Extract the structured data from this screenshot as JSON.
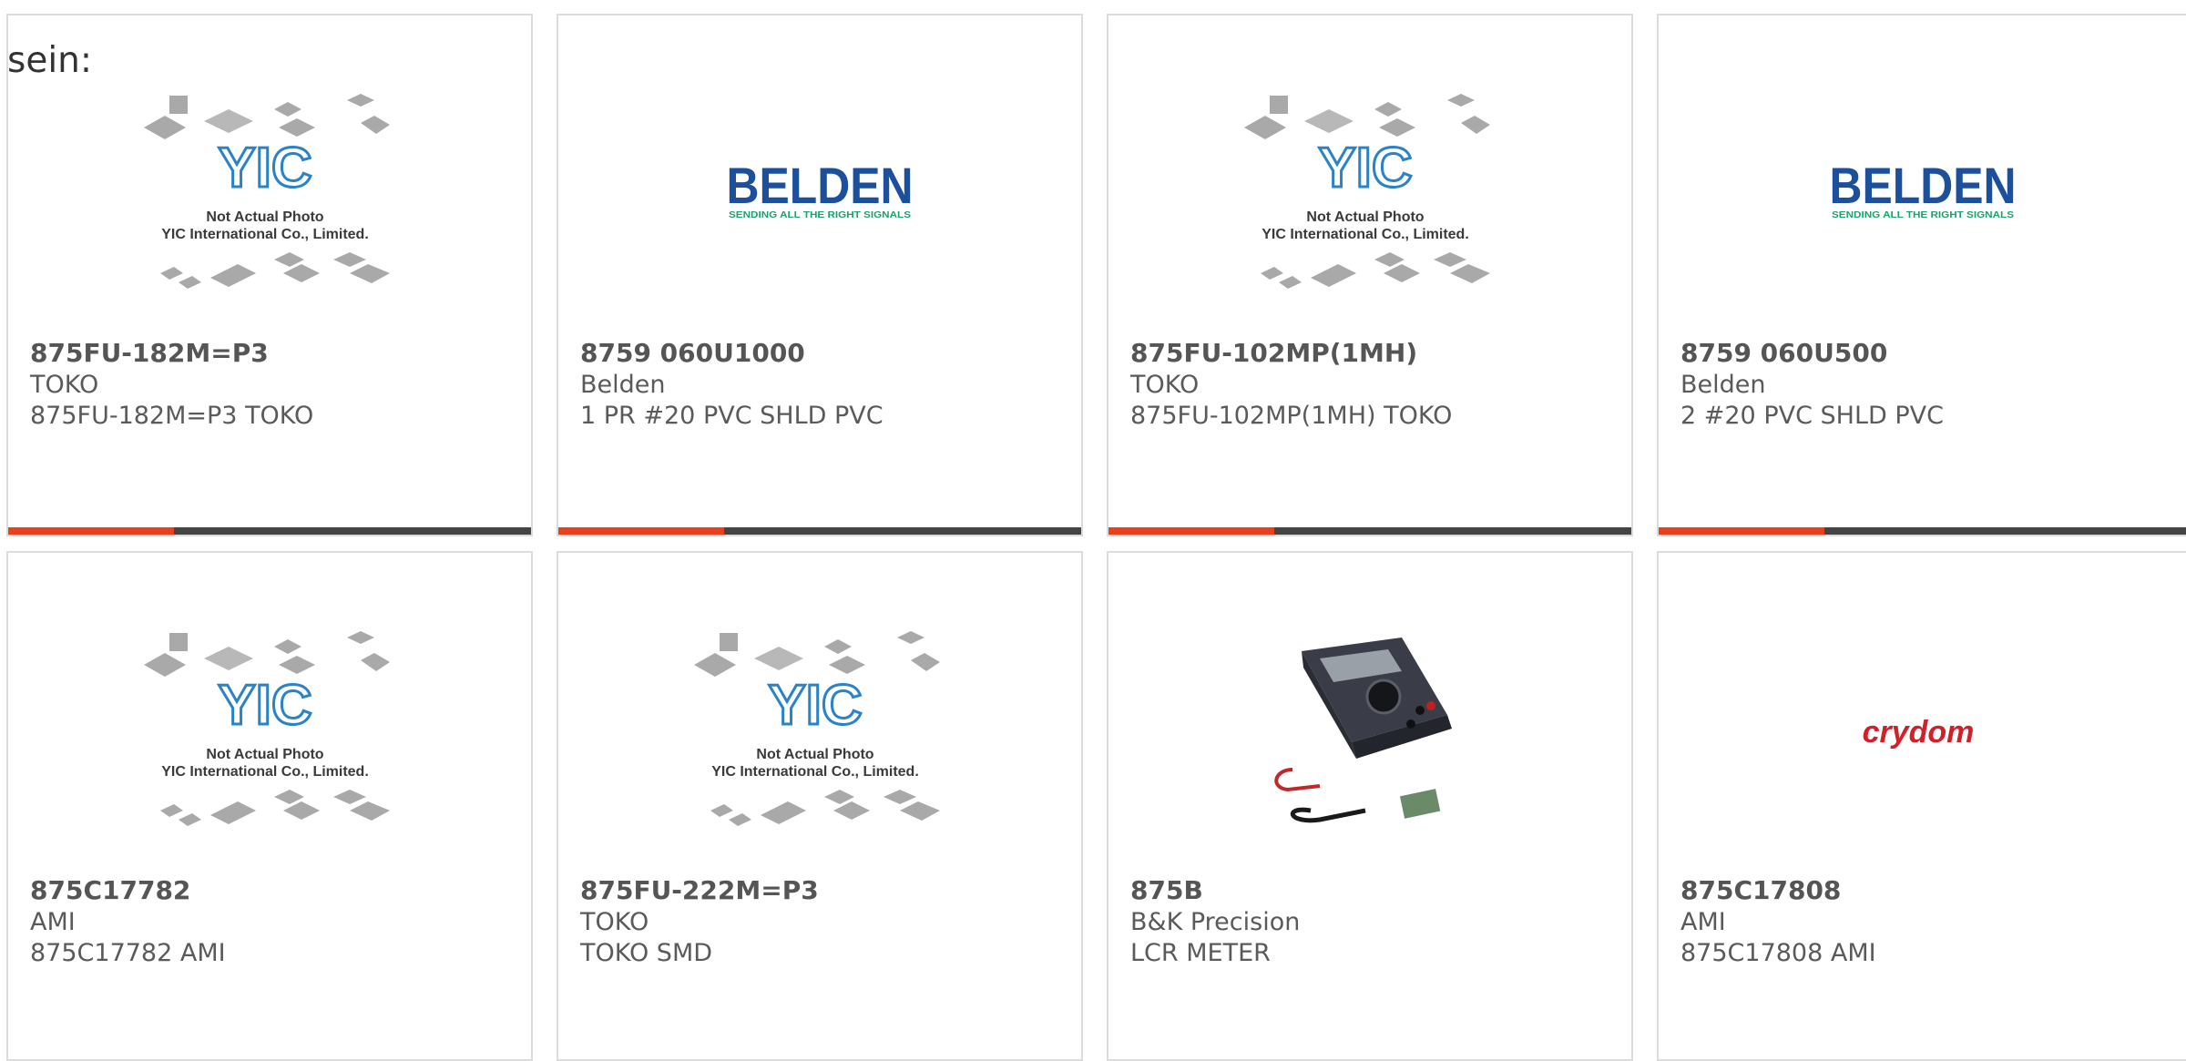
{
  "overlay_text": "sein:",
  "colors": {
    "accent": "#e8401c",
    "bar": "#444444",
    "belden_blue": "#1c4f9c",
    "belden_green": "#1aa36c",
    "crydom_red": "#d0202a",
    "yic_blue": "#2a82c8"
  },
  "placeholder": {
    "logo_text": "YIC",
    "line1": "Not Actual Photo",
    "line2": "YIC International Co., Limited."
  },
  "belden_logo": {
    "name": "BELDEN",
    "tagline": "SENDING ALL THE RIGHT SIGNALS"
  },
  "crydom_logo": {
    "name": "crydom"
  },
  "products": [
    {
      "part": "875FU-182M=P3",
      "manufacturer": "TOKO",
      "description": "875FU-182M=P3 TOKO",
      "image": "yic-placeholder"
    },
    {
      "part": "8759 060U1000",
      "manufacturer": "Belden",
      "description": "1 PR #20 PVC SHLD PVC",
      "image": "belden-logo"
    },
    {
      "part": "875FU-102MP(1MH)",
      "manufacturer": "TOKO",
      "description": "875FU-102MP(1MH) TOKO",
      "image": "yic-placeholder"
    },
    {
      "part": "8759 060U500",
      "manufacturer": "Belden",
      "description": "2 #20 PVC SHLD PVC",
      "image": "belden-logo"
    },
    {
      "part": "875C17782",
      "manufacturer": "AMI",
      "description": "875C17782 AMI",
      "image": "yic-placeholder"
    },
    {
      "part": "875FU-222M=P3",
      "manufacturer": "TOKO",
      "description": "TOKO SMD",
      "image": "yic-placeholder"
    },
    {
      "part": "875B",
      "manufacturer": "B&K Precision",
      "description": "LCR METER",
      "image": "lcr-meter-photo"
    },
    {
      "part": "875C17808",
      "manufacturer": "AMI",
      "description": "875C17808 AMI",
      "image": "crydom-logo"
    }
  ]
}
